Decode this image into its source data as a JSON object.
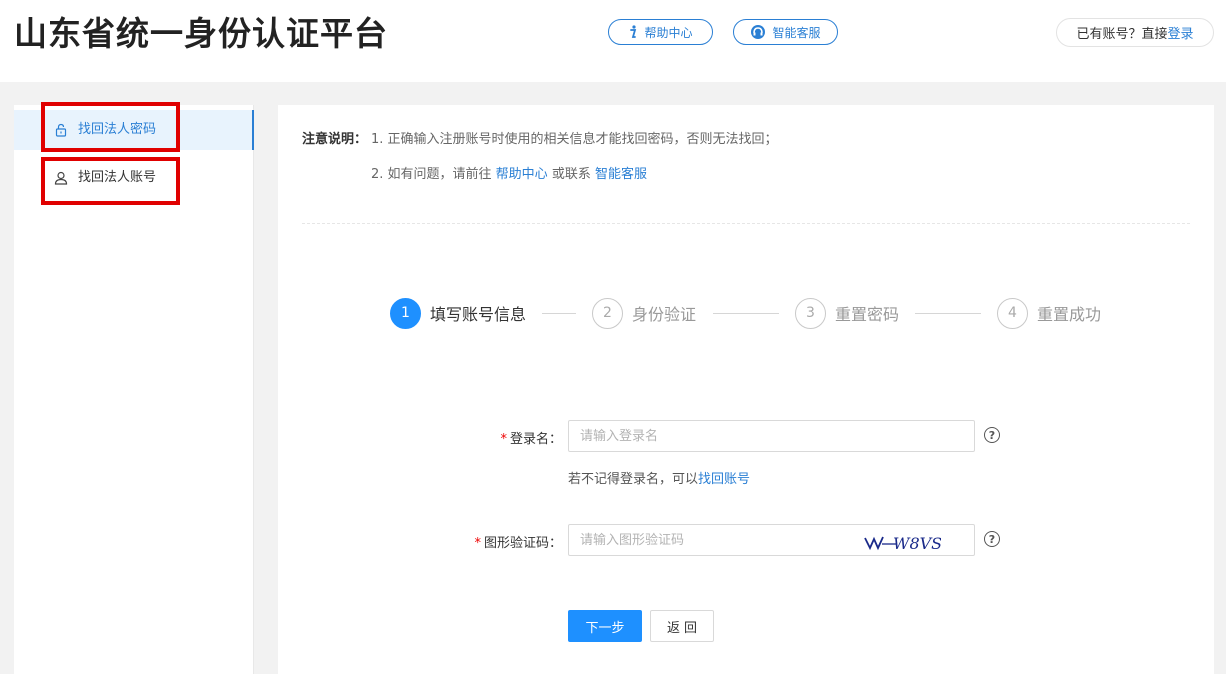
{
  "header": {
    "title": "山东省统一身份认证平台",
    "help_label": "帮助中心",
    "service_label": "智能客服",
    "login_prompt": "已有账号？直接",
    "login_link": "登录"
  },
  "sidebar": {
    "items": [
      {
        "label": "找回法人密码",
        "icon": "lock-icon",
        "active": true
      },
      {
        "label": "找回法人账号",
        "icon": "user-icon",
        "active": false
      }
    ]
  },
  "notes": {
    "label": "注意说明：",
    "line1": "1. 正确输入注册账号时使用的相关信息才能找回密码，否则无法找回；",
    "line2_prefix": "2. 如有问题，请前往 ",
    "line2_link1": "帮助中心",
    "line2_mid": " 或联系 ",
    "line2_link2": "智能客服"
  },
  "steps": [
    {
      "num": "1",
      "label": "填写账号信息",
      "active": true
    },
    {
      "num": "2",
      "label": "身份验证",
      "active": false
    },
    {
      "num": "3",
      "label": "重置密码",
      "active": false
    },
    {
      "num": "4",
      "label": "重置成功",
      "active": false
    }
  ],
  "form": {
    "login_name_label": "登录名：",
    "login_name_placeholder": "请输入登录名",
    "hint_prefix": "若不记得登录名，可以",
    "hint_link": "找回账号",
    "captcha_label": "图形验证码：",
    "captcha_placeholder": "请输入图形验证码",
    "captcha_text": "W8VS",
    "required_mark": "*",
    "help_mark": "?"
  },
  "buttons": {
    "next": "下一步",
    "back": "返回"
  },
  "colors": {
    "accent": "#1e90ff",
    "link": "#2a7fd4",
    "highlight": "#e00000"
  }
}
